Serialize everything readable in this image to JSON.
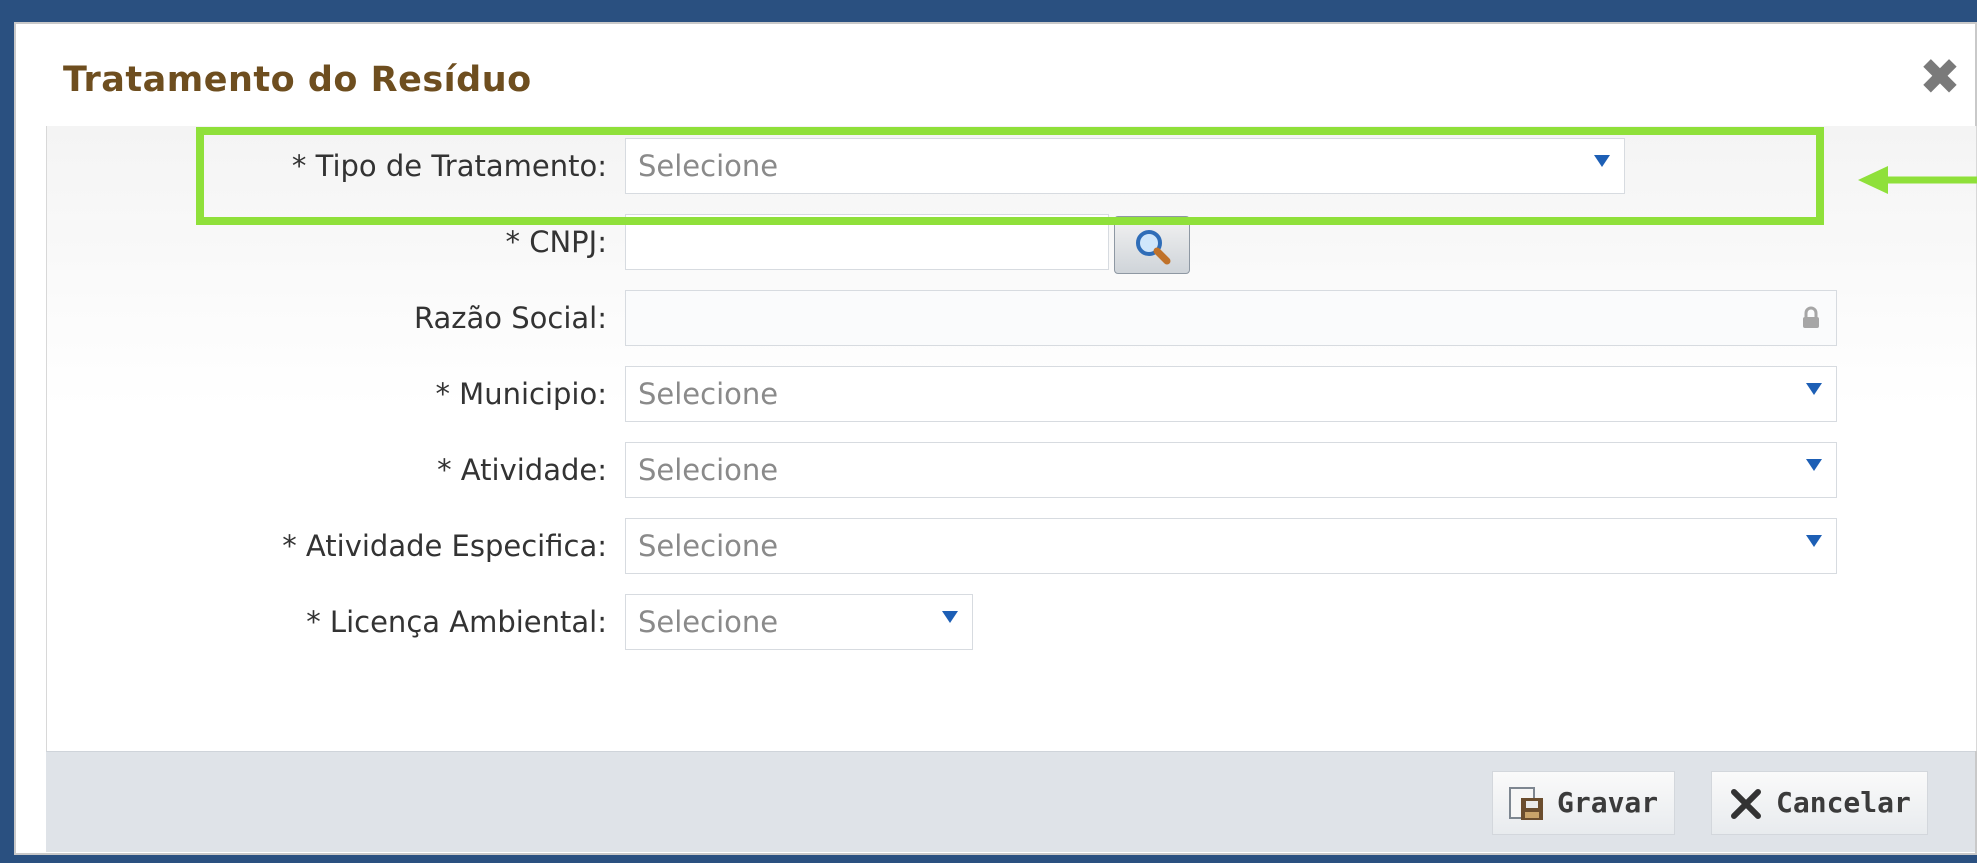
{
  "dialog": {
    "title": "Tratamento do Resíduo"
  },
  "form": {
    "tipo_tratamento": {
      "label": "* Tipo de Tratamento:",
      "value": "Selecione"
    },
    "cnpj": {
      "label": "* CNPJ:",
      "value": ""
    },
    "razao_social": {
      "label": "Razão Social:",
      "value": ""
    },
    "municipio": {
      "label": "* Municipio:",
      "value": "Selecione"
    },
    "atividade": {
      "label": "* Atividade:",
      "value": "Selecione"
    },
    "atividade_especifica": {
      "label": "* Atividade Especifica:",
      "value": "Selecione"
    },
    "licenca_ambiental": {
      "label": "* Licença Ambiental:",
      "value": "Selecione"
    }
  },
  "footer": {
    "save_label": "Gravar",
    "cancel_label": "Cancelar"
  },
  "colors": {
    "highlight": "#8fe03a",
    "title": "#6e4e1f",
    "dropdown_arrow": "#1d5fb5"
  },
  "icons": [
    "close-icon",
    "search-icon",
    "lock-icon",
    "dropdown-arrow-icon",
    "save-icon",
    "cancel-icon",
    "arrow-pointer-icon"
  ]
}
